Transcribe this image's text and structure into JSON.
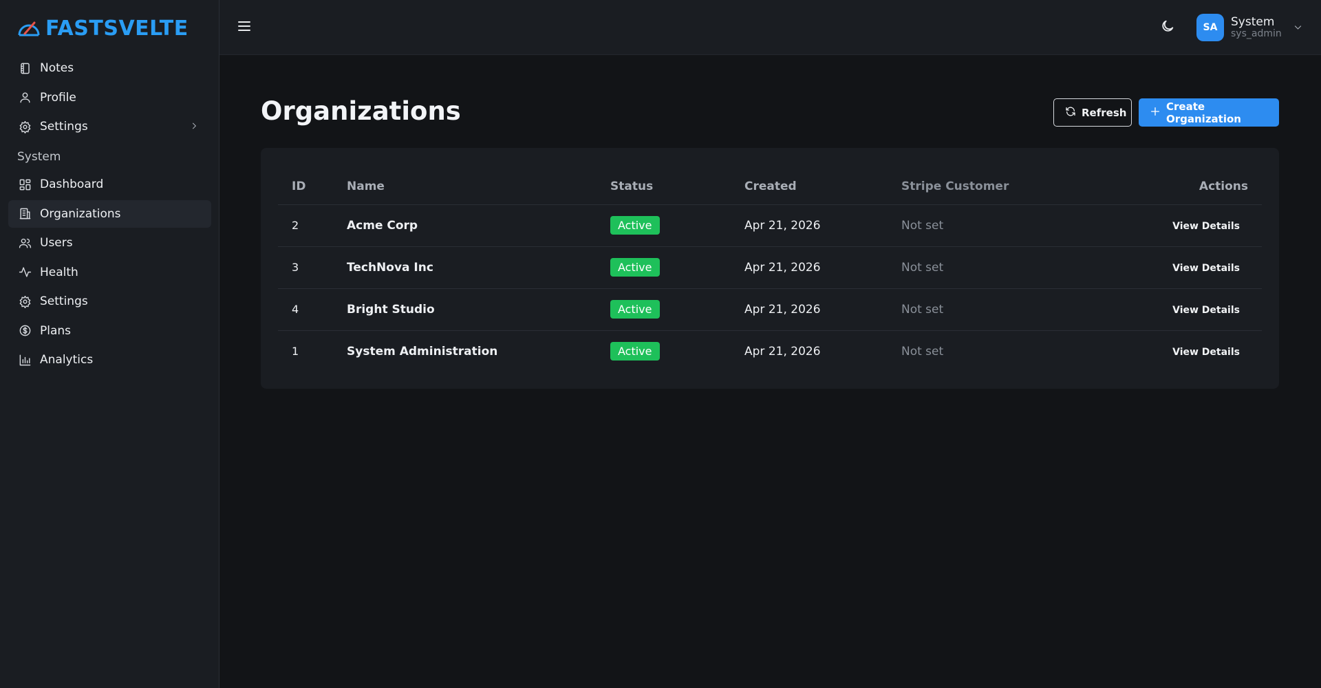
{
  "brand": {
    "name": "FASTSVELTE",
    "color": "#2a9df4"
  },
  "sidebar": {
    "top_items": [
      {
        "label": "Notes",
        "icon": "notebook-icon"
      },
      {
        "label": "Profile",
        "icon": "user-icon"
      },
      {
        "label": "Settings",
        "icon": "gear-icon",
        "has_chevron": true
      }
    ],
    "section_label": "System",
    "system_items": [
      {
        "label": "Dashboard",
        "icon": "dashboard-icon"
      },
      {
        "label": "Organizations",
        "icon": "building-icon",
        "active": true
      },
      {
        "label": "Users",
        "icon": "users-icon"
      },
      {
        "label": "Health",
        "icon": "activity-icon"
      },
      {
        "label": "Settings",
        "icon": "gear-icon"
      },
      {
        "label": "Plans",
        "icon": "dollar-circle-icon"
      },
      {
        "label": "Analytics",
        "icon": "bar-chart-icon"
      }
    ]
  },
  "topbar": {
    "user": {
      "initials": "SA",
      "name": "System",
      "handle": "sys_admin"
    }
  },
  "page": {
    "title": "Organizations",
    "refresh_label": "Refresh",
    "create_label": "Create Organization"
  },
  "table": {
    "columns": [
      "ID",
      "Name",
      "Status",
      "Created",
      "Stripe Customer",
      "Actions"
    ],
    "rows": [
      {
        "id": "2",
        "name": "Acme Corp",
        "status": "Active",
        "created": "Apr 21, 2026",
        "stripe": "Not set",
        "action": "View Details"
      },
      {
        "id": "3",
        "name": "TechNova Inc",
        "status": "Active",
        "created": "Apr 21, 2026",
        "stripe": "Not set",
        "action": "View Details"
      },
      {
        "id": "4",
        "name": "Bright Studio",
        "status": "Active",
        "created": "Apr 21, 2026",
        "stripe": "Not set",
        "action": "View Details"
      },
      {
        "id": "1",
        "name": "System Administration",
        "status": "Active",
        "created": "Apr 21, 2026",
        "stripe": "Not set",
        "action": "View Details"
      }
    ]
  },
  "colors": {
    "accent": "#2d8cf0",
    "success": "#1ec05a",
    "background": "#121417",
    "surface": "#1a1d22"
  }
}
